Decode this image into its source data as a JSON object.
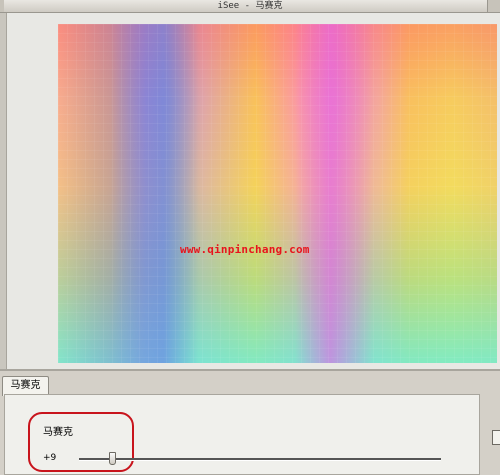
{
  "window": {
    "title": "iSee - 马赛克"
  },
  "canvas": {
    "watermark": "www.qinpinchang.com"
  },
  "tabs": [
    {
      "label": "马赛克",
      "selected": true
    }
  ],
  "mosaic_panel": {
    "label": "马赛克",
    "value_text": "+9",
    "slider": {
      "value": 9,
      "min": 0,
      "max": 100
    }
  },
  "colors": {
    "highlight": "#c8141c",
    "watermark": "#e8141c"
  }
}
